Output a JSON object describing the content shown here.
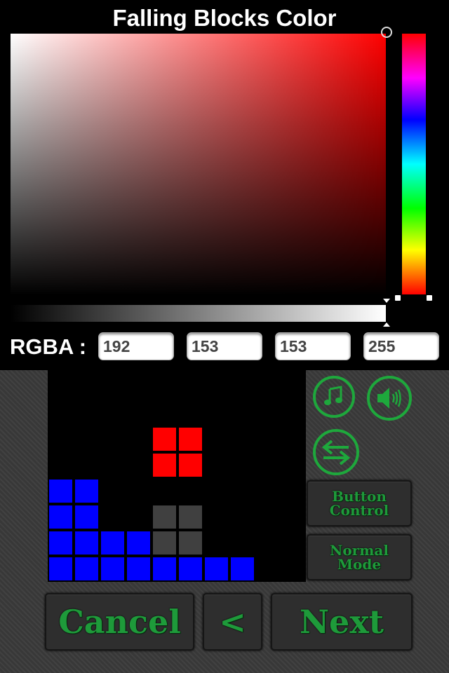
{
  "title": "Falling Blocks Color",
  "color_picker": {
    "hue_color": "#ff0000",
    "selected_color": "#c09999",
    "alpha_percent": 100
  },
  "rgba": {
    "label": "RGBA :",
    "r": "192",
    "g": "153",
    "b": "153",
    "a": "255"
  },
  "board": {
    "colors": {
      "falling": "#ff0000",
      "stack": "#0000ff",
      "ghost": "#404040"
    },
    "falling_piece": [
      [
        4,
        2
      ],
      [
        5,
        2
      ],
      [
        4,
        3
      ],
      [
        5,
        3
      ]
    ],
    "ghost_piece": [
      [
        4,
        5
      ],
      [
        5,
        5
      ],
      [
        4,
        6
      ],
      [
        5,
        6
      ]
    ],
    "stack": [
      [
        0,
        4
      ],
      [
        1,
        4
      ],
      [
        0,
        5
      ],
      [
        1,
        5
      ],
      [
        0,
        6
      ],
      [
        1,
        6
      ],
      [
        2,
        6
      ],
      [
        3,
        6
      ],
      [
        0,
        7
      ],
      [
        1,
        7
      ],
      [
        2,
        7
      ],
      [
        3,
        7
      ],
      [
        4,
        7
      ],
      [
        5,
        7
      ],
      [
        6,
        7
      ],
      [
        7,
        7
      ]
    ]
  },
  "side_controls": {
    "music_icon": "music-note-icon",
    "sound_icon": "speaker-icon",
    "swap_icon": "swap-arrows-icon",
    "button_control_label": [
      "Button",
      "Control"
    ],
    "mode_label": [
      "Normal",
      "Mode"
    ]
  },
  "footer": {
    "cancel_label": "Cancel",
    "back_label": "<",
    "next_label": "Next"
  },
  "accent_color": "#1ea83c"
}
